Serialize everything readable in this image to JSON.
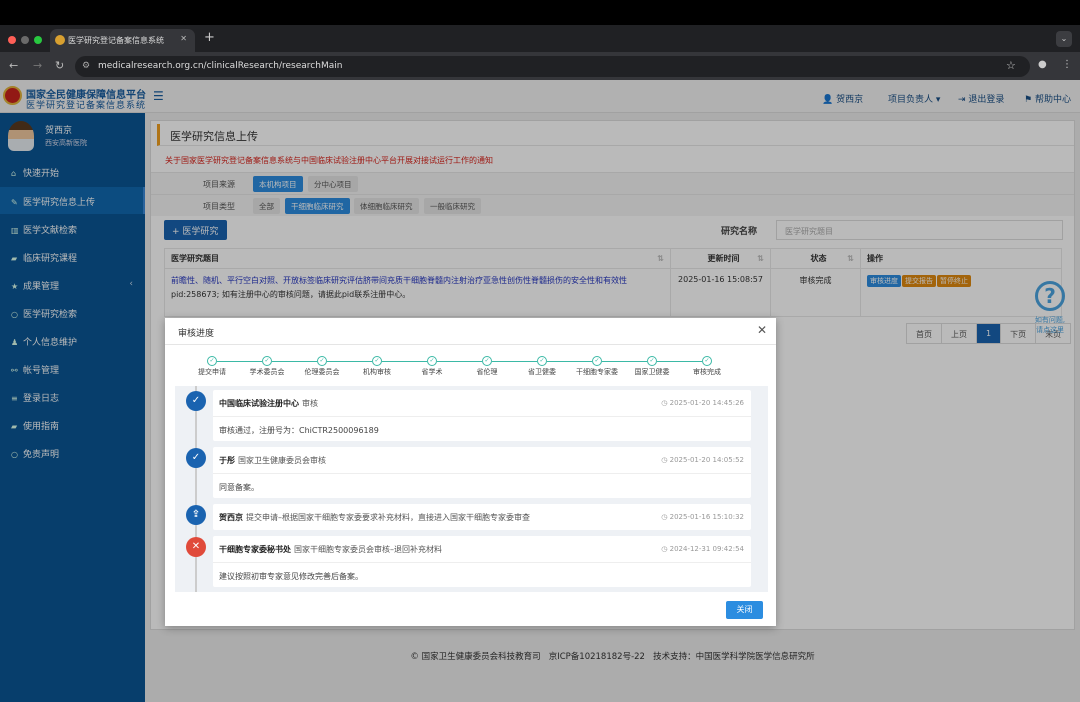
{
  "browser": {
    "tab_title": "医学研究登记备案信息系统",
    "url": "medicalresearch.org.cn/clinicalResearch/researchMain"
  },
  "header": {
    "logo_line1": "国家全民健康保障信息平台",
    "logo_line2": "医学研究登记备案信息系统",
    "user": "贺西京",
    "role": "项目负责人",
    "logout": "退出登录",
    "help": "帮助中心"
  },
  "sidebar": {
    "user_name": "贺西京",
    "org": "西安高新医院",
    "items": [
      {
        "label": "快速开始",
        "icon": "home-icon"
      },
      {
        "label": "医学研究信息上传",
        "icon": "pencil-icon"
      },
      {
        "label": "医学文献检索",
        "icon": "barcode-icon"
      },
      {
        "label": "临床研究课程",
        "icon": "book-icon"
      },
      {
        "label": "成果管理",
        "icon": "star-icon"
      },
      {
        "label": "医学研究检索",
        "icon": "circle-icon"
      },
      {
        "label": "个人信息维护",
        "icon": "user-icon"
      },
      {
        "label": "帐号管理",
        "icon": "share-icon"
      },
      {
        "label": "登录日志",
        "icon": "list-icon"
      },
      {
        "label": "使用指南",
        "icon": "book-icon"
      },
      {
        "label": "免责声明",
        "icon": "circle-icon"
      }
    ]
  },
  "main": {
    "title": "医学研究信息上传",
    "notice": "关于国家医学研究登记备案信息系统与中国临床试验注册中心平台开展对接试运行工作的通知",
    "source_label": "项目来源",
    "source_options": [
      "本机构项目",
      "分中心项目"
    ],
    "type_label": "项目类型",
    "type_options": [
      "全部",
      "干细胞临床研究",
      "体细胞临床研究",
      "一般临床研究"
    ],
    "add_button": "医学研究",
    "search_label": "研究名称",
    "search_placeholder": "医学研究题目",
    "columns": [
      "医学研究题目",
      "更新时间",
      "状态",
      "操作"
    ],
    "row": {
      "title": "前瞻性、随机、平行空白对照、开放标签临床研究评估脐带间充质干细胞脊髓内注射治疗亚急性创伤性脊髓损伤的安全性和有效性",
      "pid_note": "pid:258673; 如有注册中心的审核问题，请据此pid联系注册中心。",
      "updated": "2025-01-16 15:08:57",
      "status": "审核完成",
      "actions": [
        "审核进度",
        "提交报告",
        "暂停终止"
      ]
    },
    "pager": [
      "首页",
      "上页",
      "1",
      "下页",
      "末页"
    ],
    "help_float": "如有问题,请点这里"
  },
  "footer": {
    "copyright": "© 国家卫生健康委员会科技教育司",
    "icp": "京ICP备10218182号-22",
    "support": "技术支持：中国医学科学院医学信息研究所"
  },
  "modal": {
    "title": "审核进度",
    "steps": [
      "提交申请",
      "学术委员会",
      "伦理委员会",
      "机构审核",
      "省学术",
      "省伦理",
      "省卫健委",
      "干细胞专家委",
      "国家卫健委",
      "审核完成"
    ],
    "entries": [
      {
        "actor": "中国临床试验注册中心",
        "action": "审核",
        "time": "2025-01-20 14:45:26",
        "comment": "审核通过，注册号为：ChiCTR2500096189"
      },
      {
        "actor": "于彤",
        "action": "国家卫生健康委员会审核",
        "time": "2025-01-20 14:05:52",
        "comment": "同意备案。"
      },
      {
        "actor": "贺西京",
        "action": "提交申请–根据国家干细胞专家委要求补充材料，直接进入国家干细胞专家委审查",
        "time": "2025-01-16 15:10:32"
      },
      {
        "actor": "干细胞专家委秘书处",
        "action": "国家干细胞专家委员会审核–退回补充材料",
        "time": "2024-12-31 09:42:54",
        "comment": "建议按照初审专家意见修改完善后备案。"
      }
    ],
    "close": "关闭"
  },
  "colors": {
    "sidebar": "#0a5594",
    "primary": "#2c8de0",
    "warning": "#e08a10",
    "success": "#3bb9a6",
    "danger": "#e04a3a"
  }
}
